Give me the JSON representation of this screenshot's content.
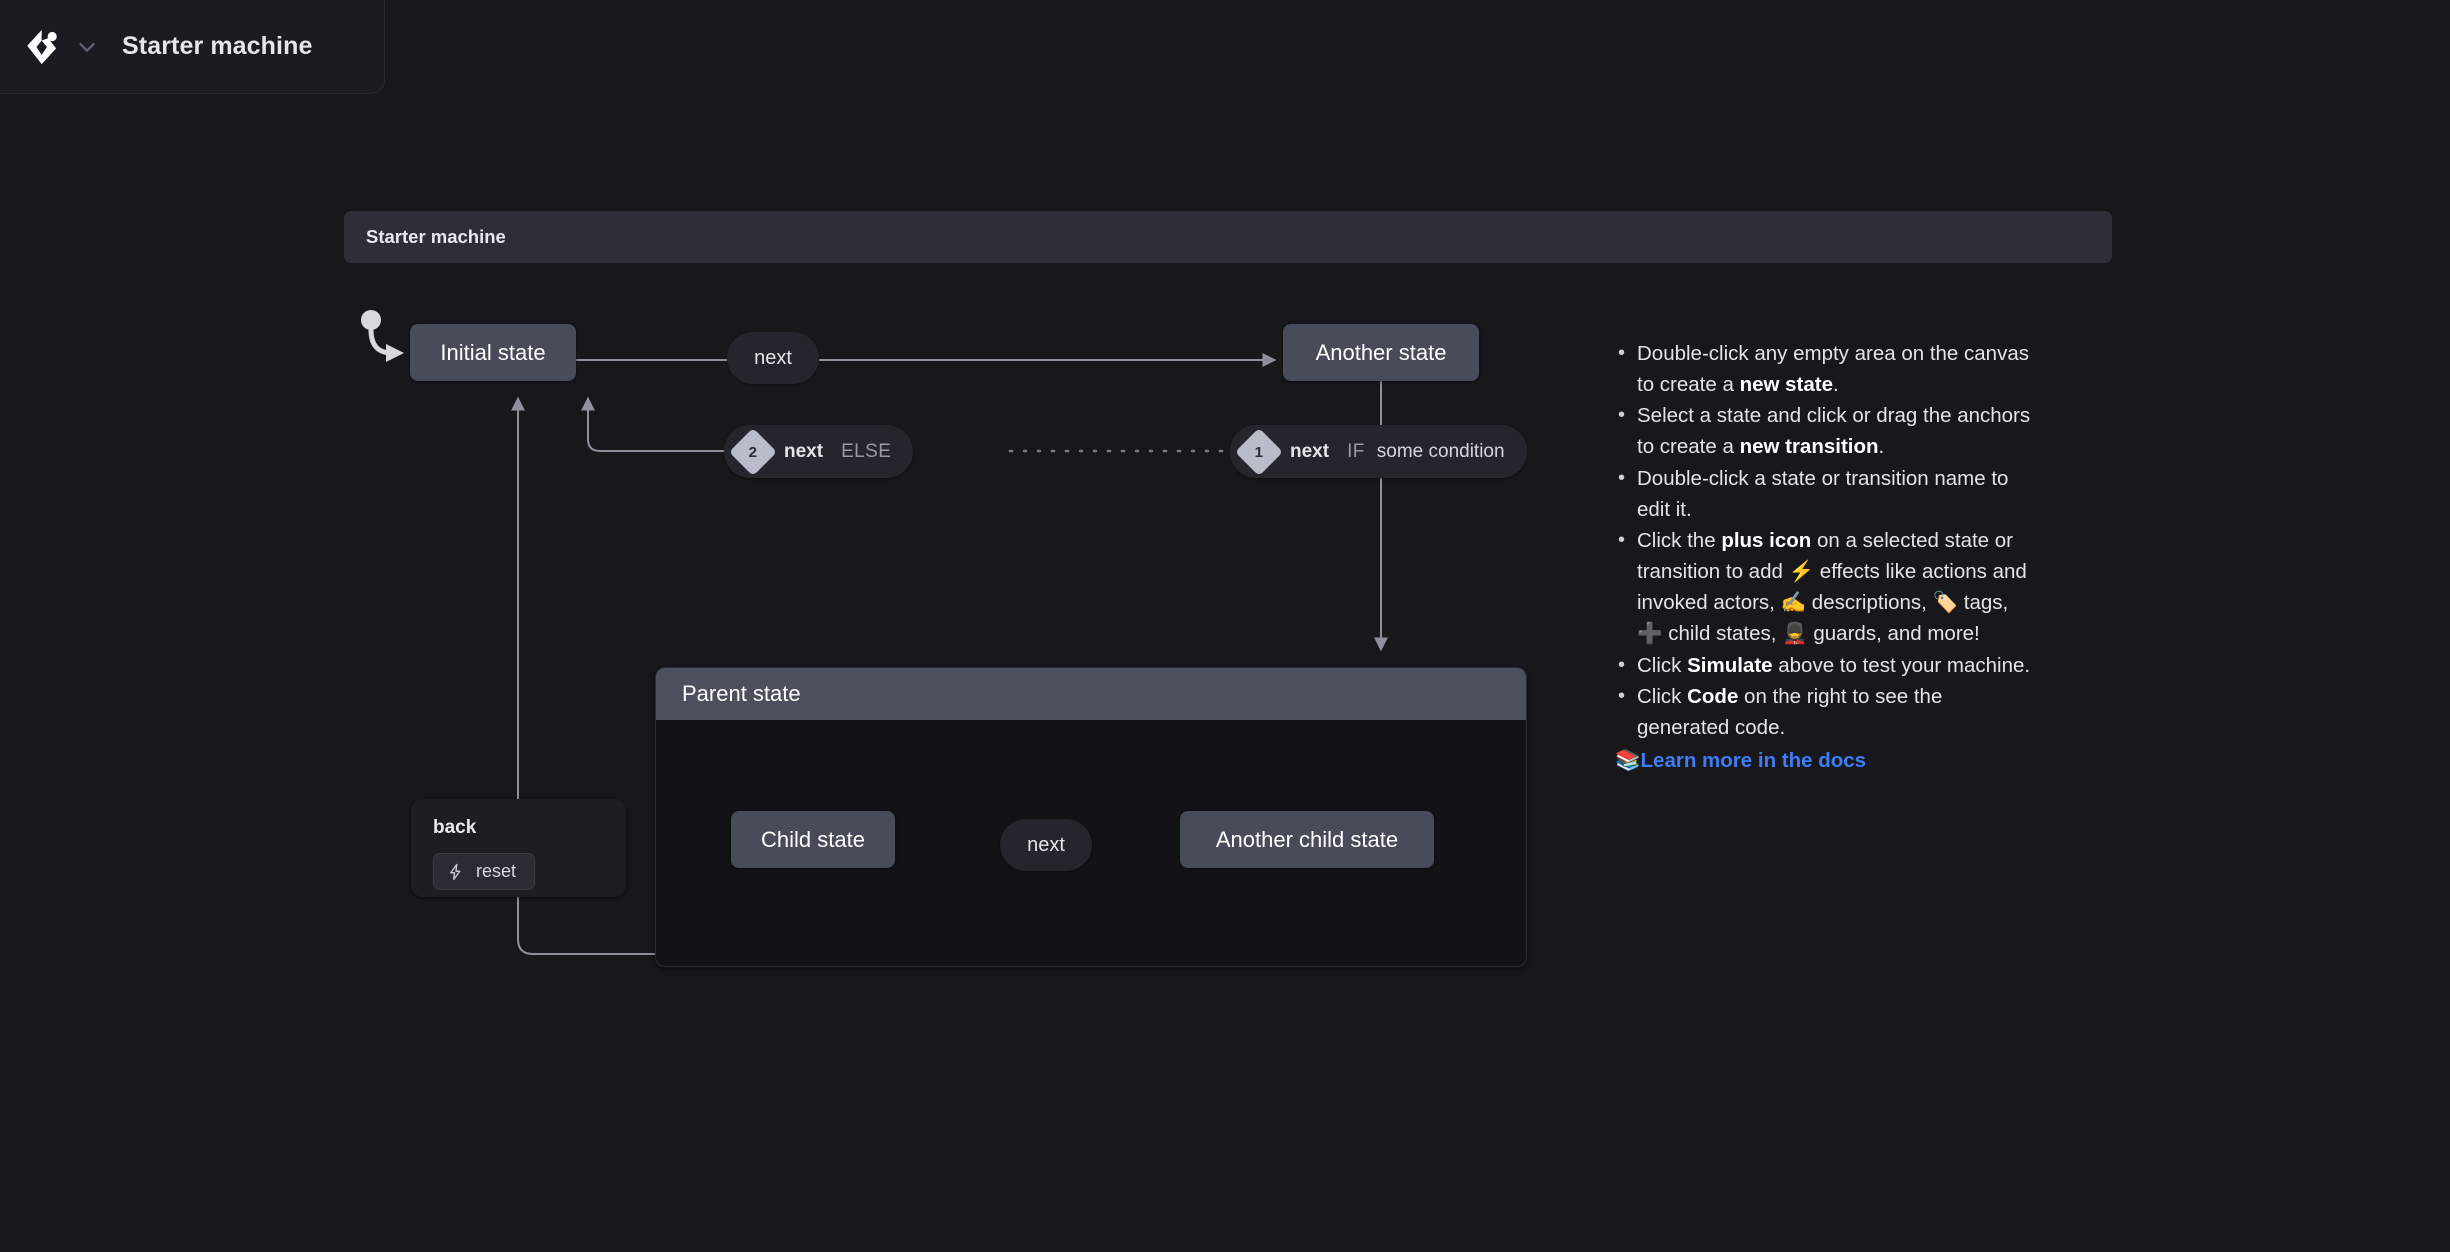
{
  "app": {
    "logo_icon": "stately-logo-icon",
    "dropdown_icon": "chevron-down-icon",
    "machine_title": "Starter machine"
  },
  "canvas": {
    "machine_frame_label": "Starter machine",
    "states": [
      {
        "id": "initial",
        "label": "Initial state"
      },
      {
        "id": "another",
        "label": "Another state"
      },
      {
        "id": "parent",
        "label": "Parent state"
      },
      {
        "id": "child",
        "label": "Child state"
      },
      {
        "id": "another_child",
        "label": "Another child state"
      }
    ],
    "transitions": [
      {
        "id": "t_next_1",
        "event": "next"
      },
      {
        "id": "t_next_child",
        "event": "next"
      },
      {
        "id": "t_if",
        "order": "1",
        "event": "next",
        "keyword": "IF",
        "condition": "some condition"
      },
      {
        "id": "t_else",
        "order": "2",
        "event": "next",
        "keyword": "ELSE",
        "condition": ""
      }
    ],
    "action_node": {
      "event_label": "back",
      "action_icon": "lightning-bolt-icon",
      "action_label": "reset"
    }
  },
  "help": {
    "items": [
      {
        "parts": [
          {
            "t": "Double-click any empty area on the canvas to create a ",
            "b": false
          },
          {
            "t": "new state",
            "b": true
          },
          {
            "t": ".",
            "b": false
          }
        ]
      },
      {
        "parts": [
          {
            "t": "Select a state and click or drag the anchors to create a ",
            "b": false
          },
          {
            "t": "new transition",
            "b": true
          },
          {
            "t": ".",
            "b": false
          }
        ]
      },
      {
        "parts": [
          {
            "t": "Double-click a state or transition name to edit it.",
            "b": false
          }
        ]
      },
      {
        "parts": [
          {
            "t": "Click the ",
            "b": false
          },
          {
            "t": "plus icon",
            "b": true
          },
          {
            "t": " on a selected state or transition to add ⚡ effects like actions and invoked actors, ✍️ descriptions, 🏷️ tags, ➕ child states, 💂 guards, and more!",
            "b": false
          }
        ]
      },
      {
        "parts": [
          {
            "t": "Click ",
            "b": false
          },
          {
            "t": "Simulate",
            "b": true
          },
          {
            "t": " above to test your machine.",
            "b": false
          }
        ]
      },
      {
        "parts": [
          {
            "t": "Click ",
            "b": false
          },
          {
            "t": "Code",
            "b": true
          },
          {
            "t": " on the right to see the generated code.",
            "b": false
          }
        ]
      }
    ],
    "docs_emoji": "📚",
    "docs_link_label": "Learn more in the docs"
  },
  "colors": {
    "background": "#17171c",
    "state_fill": "#474b5a",
    "compound_header": "#4b4f5e",
    "frame_header": "#2e2e38",
    "pill_fill": "#25252d",
    "edge": "#8f8f9d",
    "link": "#3d7df5"
  }
}
